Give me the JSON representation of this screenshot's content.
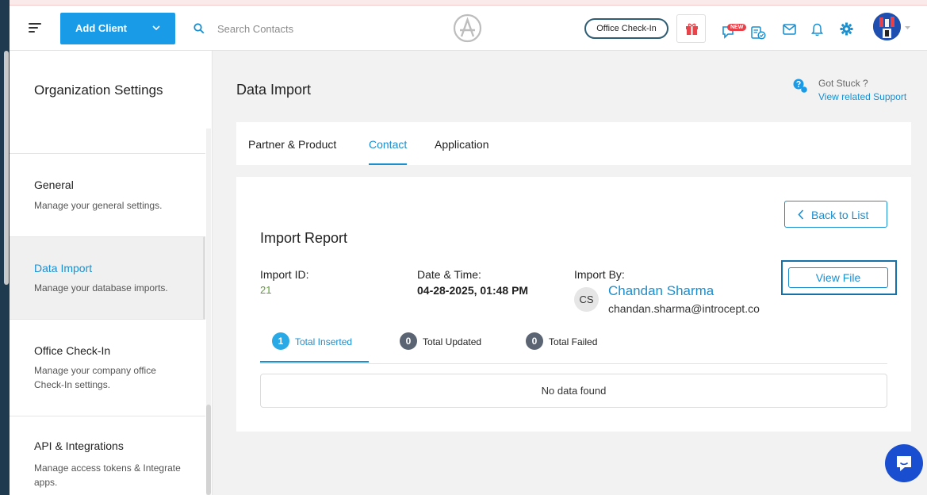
{
  "topbar": {
    "add_client_label": "Add Client",
    "search_placeholder": "Search Contacts",
    "office_checkin_label": "Office Check-In",
    "new_badge": "NEW"
  },
  "sidebar": {
    "title": "Organization Settings",
    "items": [
      {
        "title": "General",
        "desc": "Manage your general settings."
      },
      {
        "title": "Data Import",
        "desc": "Manage your database imports."
      },
      {
        "title": "Office Check-In",
        "desc": "Manage your company office Check-In settings."
      },
      {
        "title": "API & Integrations",
        "desc": "Manage access tokens & Integrate apps."
      }
    ]
  },
  "main": {
    "title": "Data Import",
    "support_question": "Got Stuck ?",
    "support_link": "View related Support",
    "tabs": [
      {
        "label": "Partner & Product"
      },
      {
        "label": "Contact"
      },
      {
        "label": "Application"
      }
    ]
  },
  "report": {
    "back_label": "Back to List",
    "title": "Import Report",
    "import_id_label": "Import ID:",
    "import_id_value": "21",
    "date_label": "Date & Time:",
    "date_value": "04-28-2025, 01:48 PM",
    "import_by_label": "Import By:",
    "user_initials": "CS",
    "user_name": "Chandan Sharma",
    "user_email": "chandan.sharma@introcept.co",
    "view_file_label": "View File",
    "stats": [
      {
        "count": "1",
        "label": "Total Inserted"
      },
      {
        "count": "0",
        "label": "Total Updated"
      },
      {
        "count": "0",
        "label": "Total Failed"
      }
    ],
    "no_data": "No data found"
  },
  "colors": {
    "accent": "#1a8fd0",
    "primary_button": "#1a9be8",
    "success": "#5aa12a",
    "sidebar_strip": "#1f3a4f"
  }
}
